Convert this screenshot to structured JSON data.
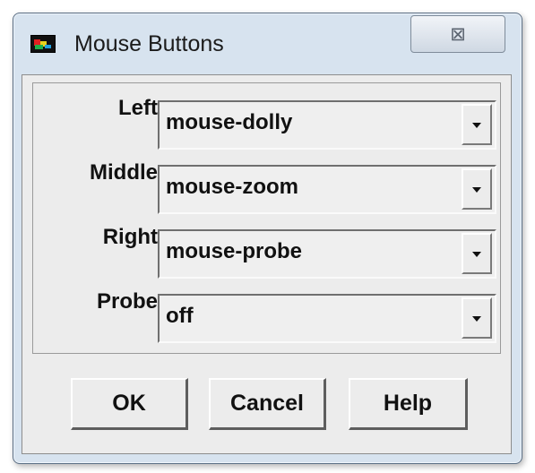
{
  "window": {
    "title": "Mouse Buttons",
    "close_glyph": "⊠"
  },
  "rows": [
    {
      "label": "Left",
      "value": "mouse-dolly"
    },
    {
      "label": "Middle",
      "value": "mouse-zoom"
    },
    {
      "label": "Right",
      "value": "mouse-probe"
    },
    {
      "label": "Probe",
      "value": "off"
    }
  ],
  "buttons": {
    "ok": "OK",
    "cancel": "Cancel",
    "help": "Help"
  }
}
